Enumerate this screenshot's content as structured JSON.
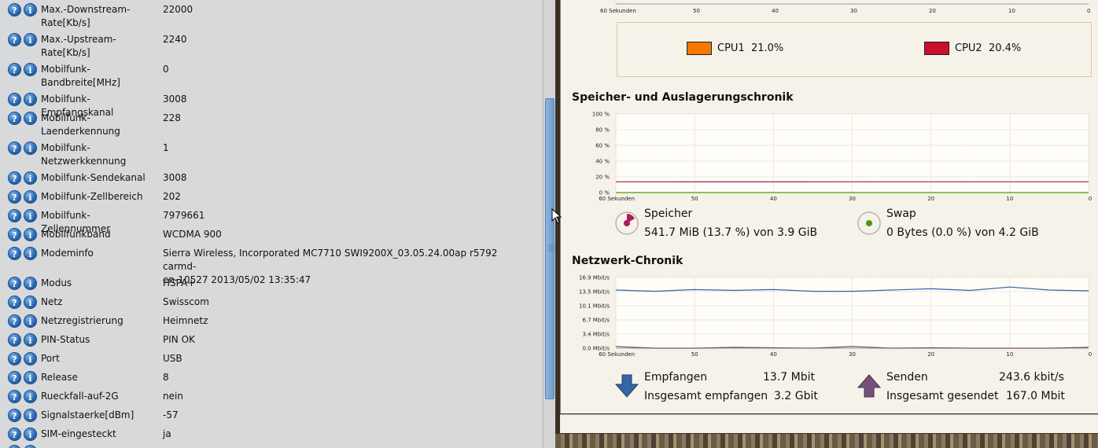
{
  "device_info": {
    "rows": [
      {
        "name": "Max.-Downstream-\nRate[Kb/s]",
        "value": "22000"
      },
      {
        "name": "Max.-Upstream-\nRate[Kb/s]",
        "value": "2240"
      },
      {
        "name": "Mobilfunk-\nBandbreite[MHz]",
        "value": "0"
      },
      {
        "name": "Mobilfunk-Empfangskanal",
        "value": "3008"
      },
      {
        "name": "Mobilfunk-\nLaenderkennung",
        "value": "228"
      },
      {
        "name": "Mobilfunk-\nNetzwerkkennung",
        "value": "1"
      },
      {
        "name": "Mobilfunk-Sendekanal",
        "value": "3008"
      },
      {
        "name": "Mobilfunk-Zellbereich",
        "value": "202"
      },
      {
        "name": "Mobilfunk-Zellennummer",
        "value": "7979661"
      },
      {
        "name": "Mobilfunkband",
        "value": "WCDMA 900"
      },
      {
        "name": "Modeminfo",
        "value": "Sierra Wireless, Incorporated MC7710 SWI9200X_03.05.24.00ap r5792 carmd-\nen-10527 2013/05/02 13:35:47"
      },
      {
        "name": "Modus",
        "value": "HSPA+"
      },
      {
        "name": "Netz",
        "value": "Swisscom"
      },
      {
        "name": "Netzregistrierung",
        "value": "Heimnetz"
      },
      {
        "name": "PIN-Status",
        "value": "PIN OK"
      },
      {
        "name": "Port",
        "value": "USB"
      },
      {
        "name": "Release",
        "value": "8"
      },
      {
        "name": "Rueckfall-auf-2G",
        "value": "nein"
      },
      {
        "name": "Signalstaerke[dBm]",
        "value": "-57"
      },
      {
        "name": "SIM-eingesteckt",
        "value": "ja"
      }
    ],
    "help_icon": "question-icon",
    "info_icon": "info-icon"
  },
  "cpu": {
    "x_ticks": [
      "60 Sekunden",
      "50",
      "40",
      "30",
      "20",
      "10",
      "0"
    ],
    "legend": [
      {
        "label": "CPU1",
        "value": "21.0%",
        "color": "#f57900"
      },
      {
        "label": "CPU2",
        "value": "20.4%",
        "color": "#cc0f2d"
      }
    ]
  },
  "memory": {
    "title": "Speicher- und Auslagerungschronik",
    "y_ticks": [
      "100 %",
      "80 %",
      "60 %",
      "40 %",
      "20 %",
      "0 %"
    ],
    "x_ticks": [
      "60 Sekunden",
      "50",
      "40",
      "30",
      "20",
      "10",
      "0"
    ],
    "memory_label": "Speicher",
    "memory_value": "541.7 MiB (13.7 %) von 3.9 GiB",
    "memory_color": "#ad1a5e",
    "swap_label": "Swap",
    "swap_value": "0 Bytes (0.0 %) von 4.2 GiB",
    "swap_color": "#4e9a06"
  },
  "network": {
    "title": "Netzwerk-Chronik",
    "y_ticks": [
      "16.9 Mbit/s",
      "13.5 Mbit/s",
      "10.1 Mbit/s",
      "6.7 Mbit/s",
      "3.4 Mbit/s",
      "0.0 Mbit/s"
    ],
    "x_ticks": [
      "60 Sekunden",
      "50",
      "40",
      "30",
      "20",
      "10",
      "0"
    ],
    "recv_label": "Empfangen",
    "recv_value": "13.7 Mbit/s",
    "recv_total_label": "Insgesamt empfangen",
    "recv_total_value": "3.2 Gbit",
    "recv_color": "#3465a4",
    "send_label": "Senden",
    "send_value": "243.6 kbit/s",
    "send_total_label": "Insgesamt gesendet",
    "send_total_value": "167.0 Mbit",
    "send_color": "#75507b"
  },
  "chart_data": [
    {
      "type": "line",
      "title": "Speicher- und Auslagerungschronik",
      "x": [
        60,
        50,
        40,
        30,
        20,
        10,
        0
      ],
      "xlabel": "",
      "ylabel": "",
      "ylim": [
        0,
        100
      ],
      "grid": true,
      "series": [
        {
          "name": "Speicher",
          "values": [
            13.7,
            13.6,
            13.6,
            13.7,
            13.7,
            13.7,
            13.7
          ]
        },
        {
          "name": "Swap",
          "values": [
            0,
            0,
            0,
            0,
            0,
            0,
            0
          ]
        }
      ]
    },
    {
      "type": "line",
      "title": "Netzwerk-Chronik",
      "x": [
        60,
        55,
        50,
        45,
        40,
        35,
        30,
        25,
        20,
        15,
        10,
        5,
        0
      ],
      "xlabel": "",
      "ylabel": "",
      "ylim": [
        0,
        16.9
      ],
      "grid": true,
      "series": [
        {
          "name": "Empfangen",
          "values": [
            13.9,
            13.6,
            14.0,
            13.8,
            14.0,
            13.6,
            13.6,
            13.9,
            14.2,
            13.8,
            14.6,
            13.9,
            13.7
          ]
        },
        {
          "name": "Senden",
          "values": [
            0.4,
            0.0,
            0.0,
            0.2,
            0.1,
            0.0,
            0.4,
            0.0,
            0.1,
            0.0,
            0.0,
            0.0,
            0.2
          ]
        }
      ]
    }
  ]
}
